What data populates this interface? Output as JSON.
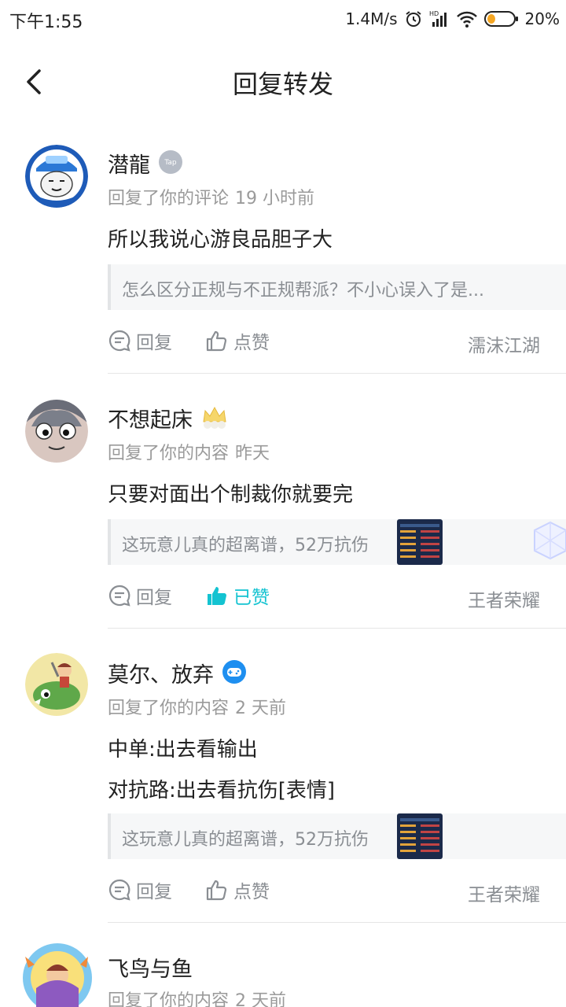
{
  "status_bar": {
    "time": "下午1:55",
    "net_speed": "1.4M/s",
    "battery": "20%",
    "icons": [
      "alarm-icon",
      "hd-signal-icon",
      "wifi-icon",
      "battery-icon"
    ]
  },
  "header": {
    "title": "回复转发",
    "back_icon": "chevron-left-icon"
  },
  "colors": {
    "accent": "#14c3d1",
    "muted": "#8a8e93",
    "divider": "#e6e6e6",
    "quote_bg": "#f6f7f8"
  },
  "items": [
    {
      "name": "潜龍",
      "badge": "tap-badge-icon",
      "badge_text": "Tap",
      "action": "回复了你的评论",
      "time": "19 小时前",
      "lines": [
        "所以我说心游良品胆子大"
      ],
      "quote": "怎么区分正规与不正规帮派？不小心误入了是...",
      "reply_label": "回复",
      "like_label": "点赞",
      "liked": false,
      "tag": "濡沫江湖"
    },
    {
      "name": "不想起床",
      "badge": "crown-badge-icon",
      "action": "回复了你的内容",
      "time": "昨天",
      "lines": [
        "只要对面出个制裁你就要完"
      ],
      "quote": "这玩意儿真的超离谱，52万抗伤",
      "reply_label": "回复",
      "like_label": "已赞",
      "liked": true,
      "tag": "王者荣耀"
    },
    {
      "name": "莫尔、放弃",
      "badge": "gamepad-badge-icon",
      "action": "回复了你的内容",
      "time": "2 天前",
      "lines": [
        "中单:出去看输出",
        "对抗路:出去看抗伤[表情]"
      ],
      "quote": "这玩意儿真的超离谱，52万抗伤",
      "reply_label": "回复",
      "like_label": "点赞",
      "liked": false,
      "tag": "王者荣耀"
    },
    {
      "name": "飞鸟与鱼",
      "action": "回复了你的内容",
      "time": "2 天前"
    }
  ]
}
